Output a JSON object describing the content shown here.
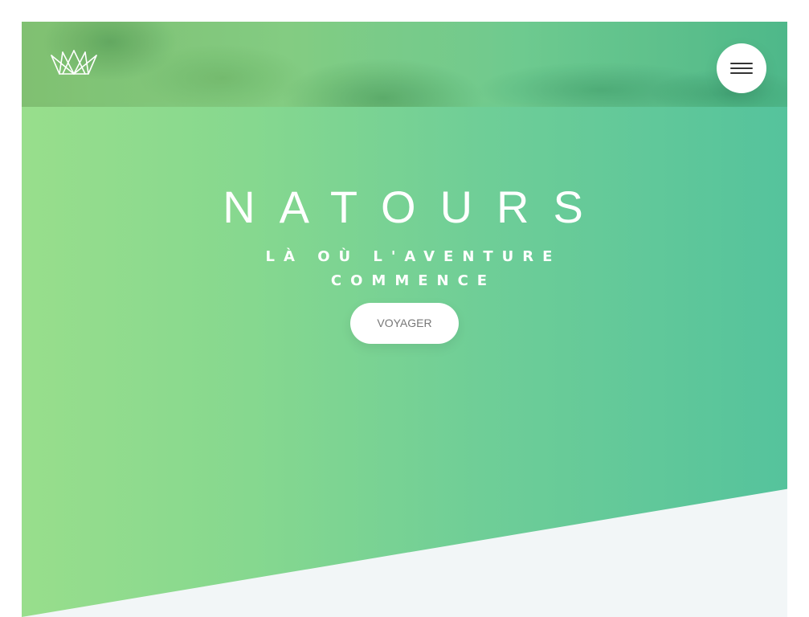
{
  "header": {
    "logo_name": "crown-logo",
    "menu_icon": "hamburger-menu-icon"
  },
  "hero": {
    "title": "NATOURS",
    "subtitle": "LÀ OÙ L'AVENTURE COMMENCE",
    "cta_label": "VOYAGER"
  },
  "colors": {
    "gradient_start": "#98de8c",
    "gradient_end": "#55c39c",
    "section_background": "#f2f6f7",
    "button_text": "#777777"
  }
}
